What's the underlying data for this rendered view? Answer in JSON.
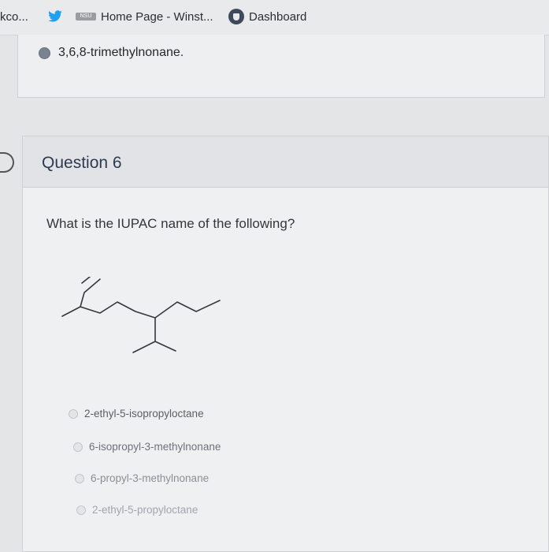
{
  "bookmarks": {
    "item1": "kco...",
    "item3": "Home Page - Winst...",
    "item3_icon_text": "NSU",
    "item4": "Dashboard"
  },
  "previous_question": {
    "selected_answer": "3,6,8-trimethylnonane."
  },
  "question": {
    "title": "Question 6",
    "text": "What is the IUPAC name of the following?",
    "options": [
      {
        "label": "2-ethyl-5-isopropyloctane"
      },
      {
        "label": "6-isopropyl-3-methylnonane"
      },
      {
        "label": "6-propyl-3-methylnonane"
      },
      {
        "label": "2-ethyl-5-propyloctane"
      }
    ]
  }
}
